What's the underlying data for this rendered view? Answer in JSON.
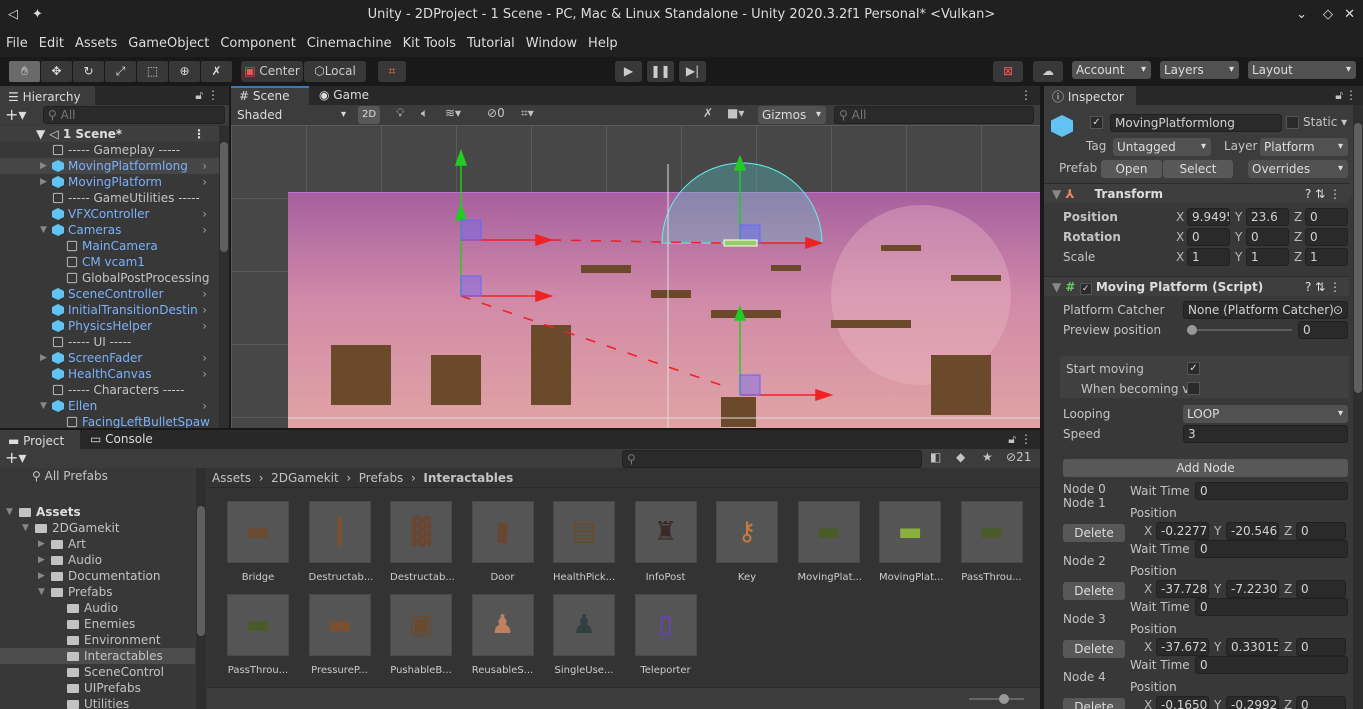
{
  "window": {
    "title": "Unity - 2DProject - 1 Scene - PC, Mac & Linux Standalone - Unity 2020.3.2f1 Personal* <Vulkan>"
  },
  "menu": [
    "File",
    "Edit",
    "Assets",
    "GameObject",
    "Component",
    "Cinemachine",
    "Kit Tools",
    "Tutorial",
    "Window",
    "Help"
  ],
  "toolbar": {
    "center": "Center",
    "local": "Local",
    "account": "Account",
    "layers": "Layers",
    "layout": "Layout",
    "tools": [
      "hand-icon",
      "move-icon",
      "rotate-icon",
      "scale-icon",
      "rect-icon",
      "transform-icon",
      "custom-tool-icon"
    ]
  },
  "hierarchy": {
    "tab": "Hierarchy",
    "search_placeholder": "All",
    "scene": "1 Scene*",
    "items": [
      {
        "label": "----- Gameplay -----",
        "indent": 1,
        "type": "line",
        "arrow": ""
      },
      {
        "label": "MovingPlatformlong",
        "indent": 1,
        "type": "blue",
        "arrow": "▶",
        "selected": true
      },
      {
        "label": "MovingPlatform",
        "indent": 1,
        "type": "blue",
        "arrow": "▶"
      },
      {
        "label": "----- GameUtilities -----",
        "indent": 1,
        "type": "line",
        "arrow": ""
      },
      {
        "label": "VFXController",
        "indent": 1,
        "type": "blue",
        "arrow": ""
      },
      {
        "label": "Cameras",
        "indent": 1,
        "type": "blue",
        "arrow": "▼"
      },
      {
        "label": "MainCamera",
        "indent": 2,
        "type": "line",
        "arrow": "",
        "blue_text": true
      },
      {
        "label": "CM vcam1",
        "indent": 2,
        "type": "line",
        "arrow": "",
        "blue_text": true
      },
      {
        "label": "GlobalPostProcessing",
        "indent": 2,
        "type": "line",
        "arrow": ""
      },
      {
        "label": "SceneController",
        "indent": 1,
        "type": "blue",
        "arrow": ""
      },
      {
        "label": "InitialTransitionDestin",
        "indent": 1,
        "type": "blue",
        "arrow": ""
      },
      {
        "label": "PhysicsHelper",
        "indent": 1,
        "type": "blue",
        "arrow": ""
      },
      {
        "label": "----- UI -----",
        "indent": 1,
        "type": "line",
        "arrow": ""
      },
      {
        "label": "ScreenFader",
        "indent": 1,
        "type": "blue",
        "arrow": "▶"
      },
      {
        "label": "HealthCanvas",
        "indent": 1,
        "type": "blue",
        "arrow": ""
      },
      {
        "label": "----- Characters -----",
        "indent": 1,
        "type": "line",
        "arrow": ""
      },
      {
        "label": "Ellen",
        "indent": 1,
        "type": "blue",
        "arrow": "▼"
      },
      {
        "label": "FacingLeftBulletSpaw",
        "indent": 2,
        "type": "line",
        "arrow": "",
        "blue_text": true
      }
    ]
  },
  "scene": {
    "tab_scene": "Scene",
    "tab_game": "Game",
    "shading": "Shaded",
    "mode_2d": "2D",
    "hidden_count": "0",
    "gizmos": "Gizmos",
    "search_placeholder": "All"
  },
  "inspector": {
    "tab": "Inspector",
    "object_name": "MovingPlatformlong",
    "static_label": "Static",
    "tag_label": "Tag",
    "tag": "Untagged",
    "layer_label": "Layer",
    "layer": "Platform",
    "prefab_label": "Prefab",
    "open": "Open",
    "select": "Select",
    "overrides": "Overrides",
    "transform": {
      "title": "Transform",
      "position_label": "Position",
      "rotation_label": "Rotation",
      "scale_label": "Scale",
      "position": [
        "9.9495",
        "23.6",
        "0"
      ],
      "rotation": [
        "0",
        "0",
        "0"
      ],
      "scale": [
        "1",
        "1",
        "1"
      ]
    },
    "script": {
      "title": "Moving Platform (Script)",
      "platform_catcher_label": "Platform Catcher",
      "platform_catcher": "None (Platform Catcher)",
      "preview_label": "Preview position",
      "preview_value": "0",
      "preview_fraction": 0,
      "start_moving_label": "Start moving",
      "start_moving": true,
      "when_becoming_label": "When becoming vi",
      "when_becoming": false,
      "looping_label": "Looping",
      "looping": "LOOP",
      "speed_label": "Speed",
      "speed": "3",
      "add_node": "Add Node",
      "wait_time_label": "Wait Time",
      "position_label": "Position",
      "delete": "Delete",
      "nodes": [
        {
          "label": "Node 0",
          "wait": "0"
        },
        {
          "label": "Node 1",
          "x": "-0.22770",
          "y": "-20.5460",
          "z": "0",
          "wait": "0"
        },
        {
          "label": "Node 2",
          "x": "-37.7281",
          "y": "-7.22300",
          "z": "0",
          "wait": "0"
        },
        {
          "label": "Node 3",
          "x": "-37.6722",
          "y": "0.33015",
          "z": "0",
          "wait": "0"
        },
        {
          "label": "Node 4",
          "x": "-0.16507",
          "y": "-0.29928",
          "z": "0"
        }
      ]
    }
  },
  "project": {
    "tab_project": "Project",
    "tab_console": "Console",
    "hidden_count": "21",
    "all_prefabs": "All Prefabs",
    "tree": [
      {
        "label": "Assets",
        "indent": 0,
        "arrow": "▼",
        "bold": true
      },
      {
        "label": "2DGamekit",
        "indent": 1,
        "arrow": "▼"
      },
      {
        "label": "Art",
        "indent": 2,
        "arrow": "▶"
      },
      {
        "label": "Audio",
        "indent": 2,
        "arrow": "▶"
      },
      {
        "label": "Documentation",
        "indent": 2,
        "arrow": "▶"
      },
      {
        "label": "Prefabs",
        "indent": 2,
        "arrow": "▼"
      },
      {
        "label": "Audio",
        "indent": 3,
        "arrow": ""
      },
      {
        "label": "Enemies",
        "indent": 3,
        "arrow": ""
      },
      {
        "label": "Environment",
        "indent": 3,
        "arrow": ""
      },
      {
        "label": "Interactables",
        "indent": 3,
        "arrow": "",
        "selected": true
      },
      {
        "label": "SceneControl",
        "indent": 3,
        "arrow": ""
      },
      {
        "label": "UIPrefabs",
        "indent": 3,
        "arrow": ""
      },
      {
        "label": "Utilities",
        "indent": 3,
        "arrow": ""
      }
    ],
    "breadcrumb": [
      "Assets",
      "2DGamekit",
      "Prefabs",
      "Interactables"
    ],
    "assets": [
      "Bridge",
      "Destructab...",
      "Destructab...",
      "Door",
      "HealthPick...",
      "InfoPost",
      "Key",
      "MovingPlat...",
      "MovingPlat...",
      "PassThrou...",
      "PassThrou...",
      "PressureP...",
      "PushableB...",
      "ReusableS...",
      "SingleUse...",
      "Teleporter"
    ]
  },
  "colors": {
    "accent": "#3a79bb",
    "selection": "#4d4d4d",
    "prefab_blue": "#7cb1f7",
    "scene_pink": "#c783a8"
  }
}
